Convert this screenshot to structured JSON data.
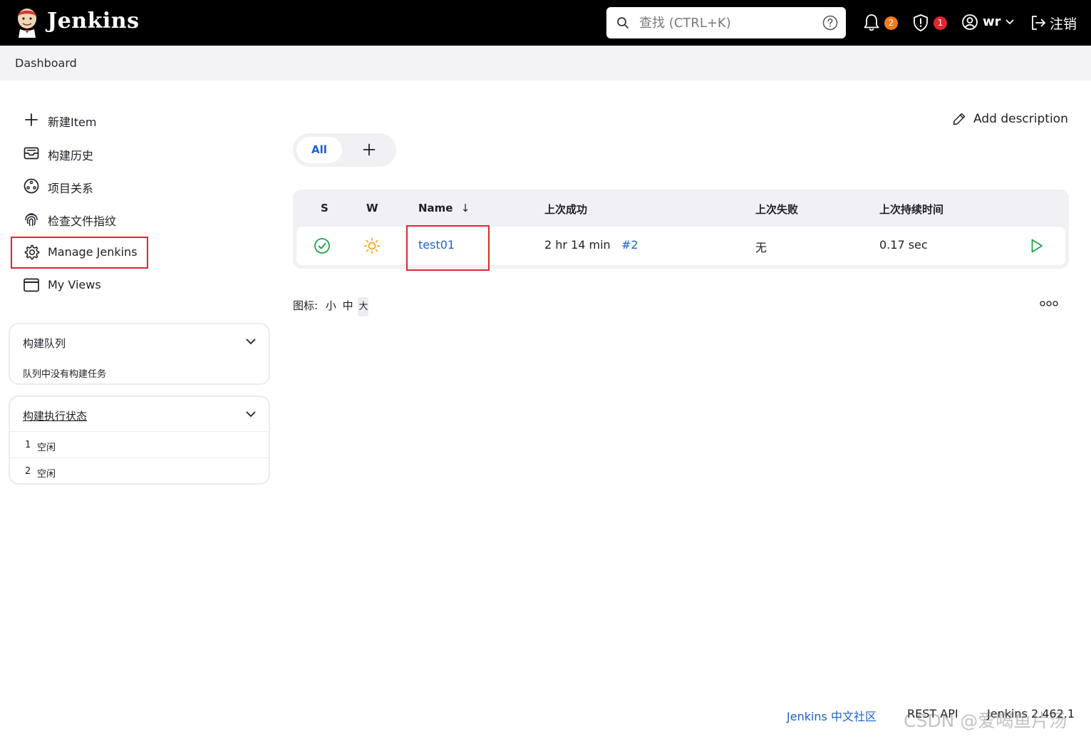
{
  "header": {
    "brand": "Jenkins",
    "search_placeholder": "查找 (CTRL+K)",
    "notifications_count": "2",
    "security_count": "1",
    "user_name": "wr",
    "logout_label": "注销",
    "colors": {
      "bar": "#000000",
      "notify_badge": "#f47b1c",
      "security_badge": "#e0262f"
    }
  },
  "breadcrumb": {
    "current": "Dashboard"
  },
  "sidebar": {
    "tasks": [
      {
        "label": "新建Item",
        "icon": "plus-icon"
      },
      {
        "label": "构建历史",
        "icon": "inbox-icon"
      },
      {
        "label": "项目关系",
        "icon": "relationship-icon"
      },
      {
        "label": "检查文件指纹",
        "icon": "fingerprint-icon"
      },
      {
        "label": "Manage Jenkins",
        "icon": "gear-icon"
      },
      {
        "label": "My Views",
        "icon": "window-icon"
      }
    ],
    "build_queue": {
      "title": "构建队列",
      "empty_text": "队列中没有构建任务"
    },
    "executors": {
      "title": "构建执行状态",
      "rows": [
        {
          "number": "1",
          "status": "空闲"
        },
        {
          "number": "2",
          "status": "空闲"
        }
      ]
    }
  },
  "main": {
    "add_description": "Add description",
    "tabs": [
      {
        "label": "All"
      }
    ],
    "table": {
      "headers": {
        "s": "S",
        "w": "W",
        "name": "Name",
        "name_sort": "↓",
        "last_success": "上次成功",
        "last_failure": "上次失败",
        "last_duration": "上次持续时间"
      },
      "rows": [
        {
          "name": "test01",
          "last_success": "2 hr 14 min",
          "last_success_build": "#2",
          "last_failure": "无",
          "last_duration": "0.17 sec",
          "status_icon": "success-check-icon",
          "weather_icon": "sunny-icon"
        }
      ]
    },
    "icon_legend": {
      "label": "图标:",
      "small": "小",
      "medium": "中",
      "large": "大"
    }
  },
  "footer": {
    "community_link": "Jenkins 中文社区",
    "rest_api": "REST API",
    "version": "Jenkins 2.462.1",
    "watermark": "CSDN @爱喝鱼片汤"
  }
}
